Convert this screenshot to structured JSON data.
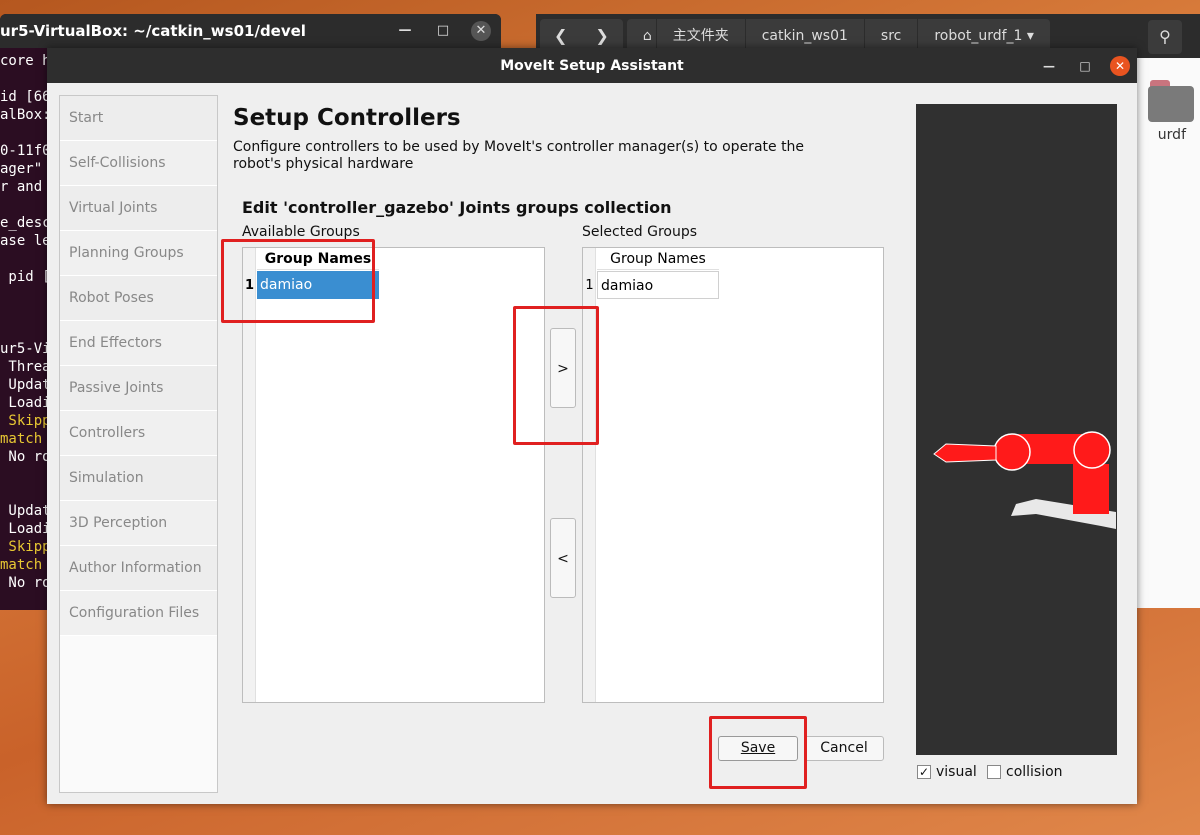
{
  "terminal": {
    "title": "ur5-VirtualBox: ~/catkin_ws01/devel",
    "lines": [
      "core ht",
      "",
      "id [66",
      "alBox:",
      "",
      "0-11f0",
      "ager\"",
      "r and",
      "",
      "e_desc",
      "ase le",
      "",
      " pid [",
      "",
      "",
      "",
      "ur5-Virt",
      " Threa",
      " Updat",
      " Loadi",
      " Skipp",
      "match",
      " No ro",
      "",
      "",
      " Updat",
      " Loadi",
      " Skipp",
      "match",
      " No ro"
    ]
  },
  "file_manager": {
    "path": [
      "主文件夹",
      "catkin_ws01",
      "src",
      "robot_urdf_1"
    ],
    "folder_label": "urdf"
  },
  "dialog": {
    "title": "MoveIt Setup Assistant",
    "nav": [
      "Start",
      "Self-Collisions",
      "Virtual Joints",
      "Planning Groups",
      "Robot Poses",
      "End Effectors",
      "Passive Joints",
      "Controllers",
      "Simulation",
      "3D Perception",
      "Author Information",
      "Configuration Files"
    ],
    "heading": "Setup Controllers",
    "description": "Configure controllers to be used by MoveIt's controller manager(s) to operate the robot's physical hardware",
    "subheading": "Edit 'controller_gazebo' Joints groups collection",
    "available": {
      "label": "Available Groups",
      "column": "Group Names",
      "rows": [
        {
          "num": "1",
          "name": "damiao"
        }
      ]
    },
    "selected": {
      "label": "Selected Groups",
      "column": "Group Names",
      "rows": [
        {
          "num": "1",
          "name": "damiao"
        }
      ]
    },
    "add_button": ">",
    "remove_button": "<",
    "save_button": "Save",
    "cancel_button": "Cancel",
    "visual_label": "visual",
    "collision_label": "collision",
    "visual_checked": true,
    "collision_checked": false
  },
  "colors": {
    "highlight": "#e02020",
    "selection": "#3a8ed1",
    "robot": "#ff1a1a",
    "viewer_bg": "#303030"
  }
}
